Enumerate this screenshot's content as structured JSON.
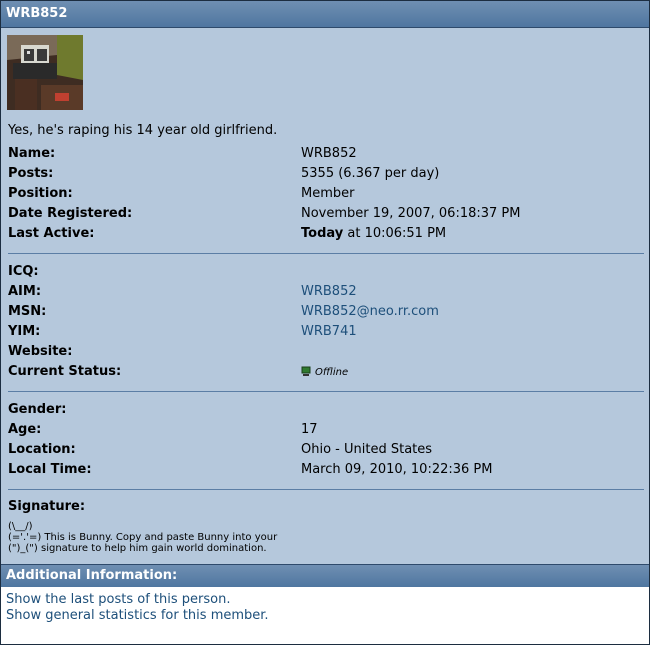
{
  "profile": {
    "title": "WRB852",
    "quote": "Yes, he's raping his 14 year old girlfriend."
  },
  "basic": [
    {
      "label": "Name:",
      "value": "WRB852"
    },
    {
      "label": "Posts:",
      "value": "5355 (6.367 per day)"
    },
    {
      "label": "Position:",
      "value": "Member"
    },
    {
      "label": "Date Registered:",
      "value": "November 19, 2007, 06:18:37 PM"
    },
    {
      "label": "Last Active:",
      "value_bold": "Today",
      "value_rest": " at 10:06:51 PM"
    }
  ],
  "contact": [
    {
      "label": "ICQ:",
      "value": ""
    },
    {
      "label": "AIM:",
      "value": "WRB852"
    },
    {
      "label": "MSN:",
      "value": "WRB852@neo.rr.com"
    },
    {
      "label": "YIM:",
      "value": "WRB741"
    },
    {
      "label": "Website:",
      "value": ""
    },
    {
      "label": "Current Status:",
      "value": "Offline",
      "icon": "offline-status-icon"
    }
  ],
  "personal": [
    {
      "label": "Gender:",
      "value": ""
    },
    {
      "label": "Age:",
      "value": "17"
    },
    {
      "label": "Location:",
      "value": "Ohio - United States"
    },
    {
      "label": "Local Time:",
      "value": "March 09, 2010, 10:22:36 PM"
    }
  ],
  "signature": {
    "label": "Signature:",
    "line1": "(\\__/)",
    "line2": "(='.'=) This is Bunny. Copy and paste Bunny into your",
    "line3": "(\")_(\") signature to help him gain world domination."
  },
  "additional": {
    "header": "Additional Information:",
    "link1": "Show the last posts of this person.",
    "link2": "Show general statistics for this member."
  },
  "colors": {
    "background": "#b5c8dc",
    "header": "#5a7fa8",
    "link": "#1d4f7a"
  }
}
